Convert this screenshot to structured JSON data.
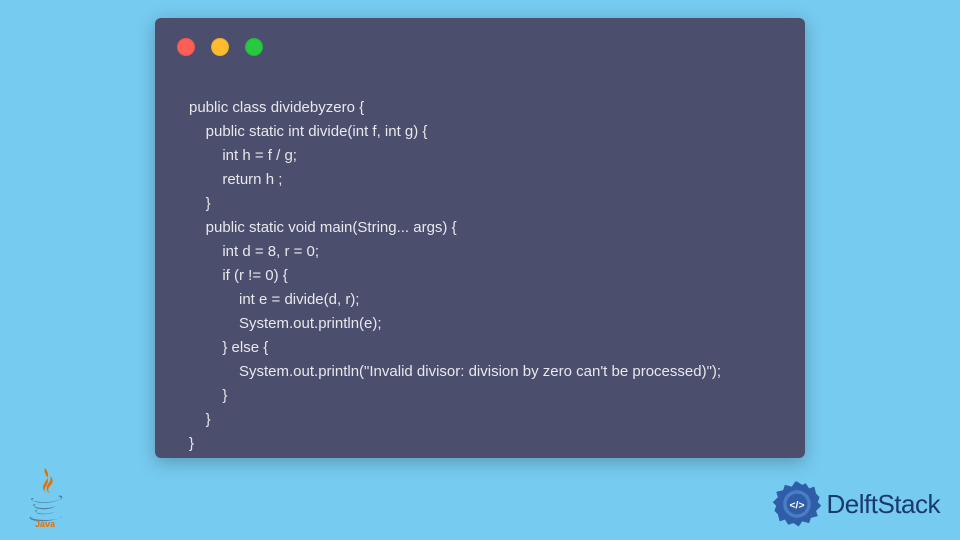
{
  "window": {
    "traffic_lights": [
      "red",
      "yellow",
      "green"
    ]
  },
  "code": {
    "lines": [
      "public class dividebyzero {",
      "    public static int divide(int f, int g) {",
      "        int h = f / g;",
      "        return h ;",
      "    }",
      "    public static void main(String... args) {",
      "        int d = 8, r = 0;",
      "        if (r != 0) {",
      "            int e = divide(d, r);",
      "            System.out.println(e);",
      "        } else {",
      "            System.out.println(\"Invalid divisor: division by zero can't be processed)\");",
      "        }",
      "    }",
      "}"
    ]
  },
  "logos": {
    "java_label": "Java",
    "delft_label": "DelftStack"
  }
}
